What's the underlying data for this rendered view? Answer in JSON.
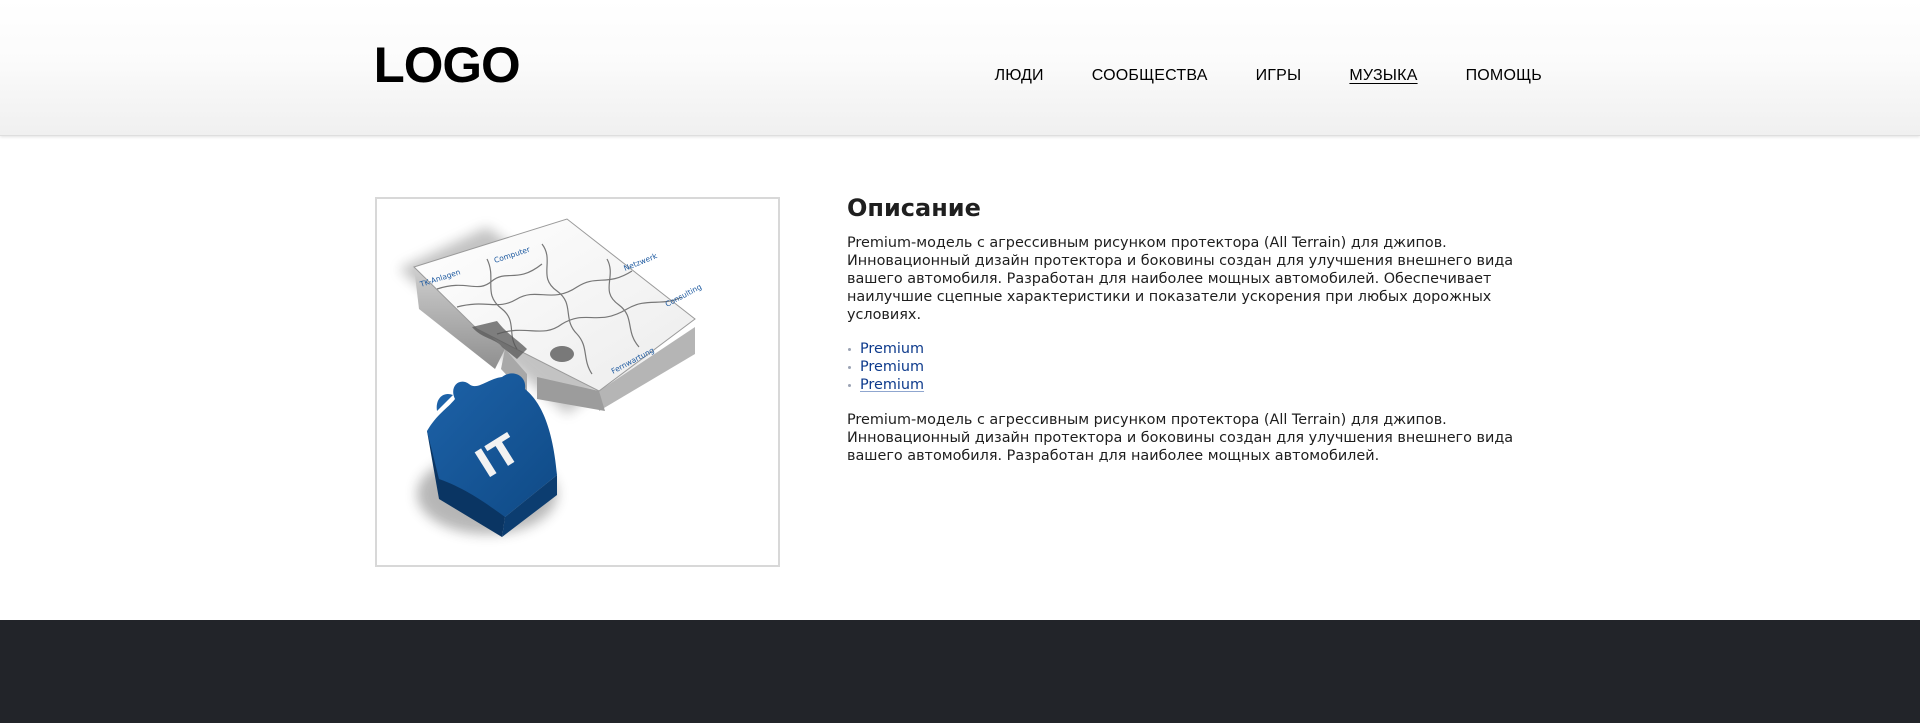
{
  "header": {
    "logo": "LOGO",
    "nav": [
      {
        "label": "ЛЮДИ",
        "active": false
      },
      {
        "label": "СООБЩЕСТВА",
        "active": false
      },
      {
        "label": "ИГРЫ",
        "active": false
      },
      {
        "label": "МУЗЫКА",
        "active": true
      },
      {
        "label": "ПОМОЩЬ",
        "active": false
      }
    ]
  },
  "product": {
    "image_labels": {
      "piece1": "TK-Anlagen",
      "piece2": "Computer",
      "piece3": "Netzwerk",
      "piece4": "Consulting",
      "piece5": "Fernwartung",
      "blue_piece": "IT"
    }
  },
  "description": {
    "heading": "Описание",
    "paragraph1": "Premium-модель с агрессивным рисунком протектора (All Terrain) для джипов. Инновационный дизайн протектора и боковины создан для улучшения внешнего вида вашего автомобиля. Разработан для наиболее мощных автомобилей. Обеспечивает наилучшие сцепные характеристики и показатели ускорения при любых дорожных условиях.",
    "links": [
      "Premium",
      "Premium",
      "Premium"
    ],
    "paragraph2": "Premium-модель с агрессивным рисунком протектора (All Terrain) для джипов. Инновационный дизайн протектора и боковины создан для улучшения внешнего вида вашего автомобиля. Разработан для наиболее мощных автомобилей."
  },
  "colors": {
    "link": "#0d3a8c",
    "footer": "#222429",
    "puzzle_blue": "#0f4a86"
  }
}
